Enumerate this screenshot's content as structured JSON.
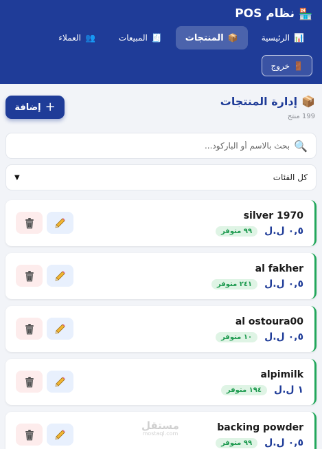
{
  "header": {
    "brand": "نظام POS",
    "nav": [
      {
        "label": "الرئيسية"
      },
      {
        "label": "المنتجات"
      },
      {
        "label": "المبيعات"
      },
      {
        "label": "العملاء"
      }
    ],
    "logout_label": "خروج"
  },
  "page": {
    "title": "إدارة المنتجات",
    "count": "199 منتج",
    "add_label": "إضافة"
  },
  "search": {
    "placeholder": "بحث بالاسم أو الباركود..."
  },
  "filter": {
    "selected": "كل الفئات"
  },
  "products": [
    {
      "name": "silver 1970",
      "price": "٠,٥ ل.ل",
      "stock": "٩٩ متوفر"
    },
    {
      "name": "al fakher",
      "price": "٠,٥ ل.ل",
      "stock": "٢٤١ متوفر"
    },
    {
      "name": "al ostoura00",
      "price": "٠,٥ ل.ل",
      "stock": "١٠ متوفر"
    },
    {
      "name": "alpimilk",
      "price": "١ ل.ل",
      "stock": "١٩٤ متوفر"
    },
    {
      "name": "backing powder",
      "price": "٠,٥ ل.ل",
      "stock": "٩٩ متوفر"
    }
  ],
  "watermark": {
    "text": "مستقل",
    "sub": "mostaql.com"
  },
  "colors": {
    "primary": "#1f3c98",
    "success": "#22a75b",
    "danger_bg": "#fdecec",
    "edit_bg": "#e8f0fd"
  }
}
